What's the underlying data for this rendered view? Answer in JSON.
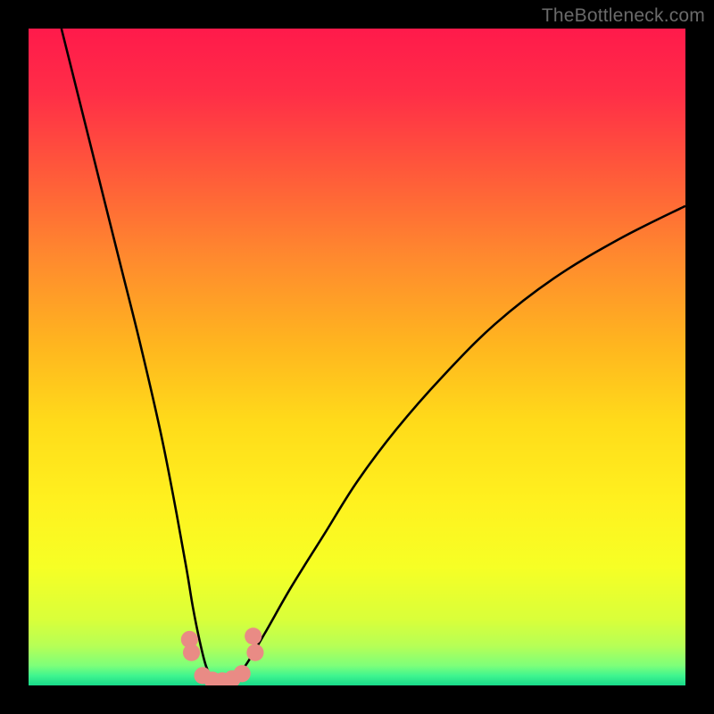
{
  "watermark": "TheBottleneck.com",
  "chart_data": {
    "type": "line",
    "title": "",
    "xlabel": "",
    "ylabel": "",
    "xlim": [
      0,
      100
    ],
    "ylim": [
      0,
      100
    ],
    "grid": false,
    "series": [
      {
        "name": "bottleneck-curve",
        "x": [
          5,
          8,
          11,
          14,
          17,
          20,
          22,
          24,
          25,
          26,
          27,
          28,
          29,
          30,
          31,
          33,
          36,
          40,
          45,
          50,
          56,
          63,
          71,
          80,
          90,
          100
        ],
        "y": [
          100,
          88,
          76,
          64,
          52,
          39,
          29,
          18,
          12,
          7,
          3,
          1,
          0,
          0,
          1,
          3,
          8,
          15,
          23,
          31,
          39,
          47,
          55,
          62,
          68,
          73
        ]
      }
    ],
    "markers": [
      {
        "name": "marker",
        "x": 24.5,
        "y": 7
      },
      {
        "name": "marker",
        "x": 24.8,
        "y": 5
      },
      {
        "name": "marker",
        "x": 26.5,
        "y": 1.5
      },
      {
        "name": "marker",
        "x": 28,
        "y": 0.8
      },
      {
        "name": "marker",
        "x": 29.5,
        "y": 0.7
      },
      {
        "name": "marker",
        "x": 31,
        "y": 1.0
      },
      {
        "name": "marker",
        "x": 32.5,
        "y": 1.8
      },
      {
        "name": "marker",
        "x": 34.5,
        "y": 5
      },
      {
        "name": "marker",
        "x": 34.2,
        "y": 7.5
      }
    ],
    "gradient_stops": [
      {
        "offset": 0,
        "color": "#ff1a4b"
      },
      {
        "offset": 0.1,
        "color": "#ff2e47"
      },
      {
        "offset": 0.22,
        "color": "#ff5a3a"
      },
      {
        "offset": 0.35,
        "color": "#ff8a2e"
      },
      {
        "offset": 0.48,
        "color": "#ffb51f"
      },
      {
        "offset": 0.6,
        "color": "#ffdb1a"
      },
      {
        "offset": 0.72,
        "color": "#fff11f"
      },
      {
        "offset": 0.82,
        "color": "#f6ff25"
      },
      {
        "offset": 0.9,
        "color": "#d9ff3a"
      },
      {
        "offset": 0.94,
        "color": "#b6ff56"
      },
      {
        "offset": 0.97,
        "color": "#7dff7a"
      },
      {
        "offset": 0.985,
        "color": "#40f58f"
      },
      {
        "offset": 1.0,
        "color": "#18d98a"
      }
    ],
    "curve_stroke": "#000000",
    "marker_fill": "#e98b85"
  }
}
